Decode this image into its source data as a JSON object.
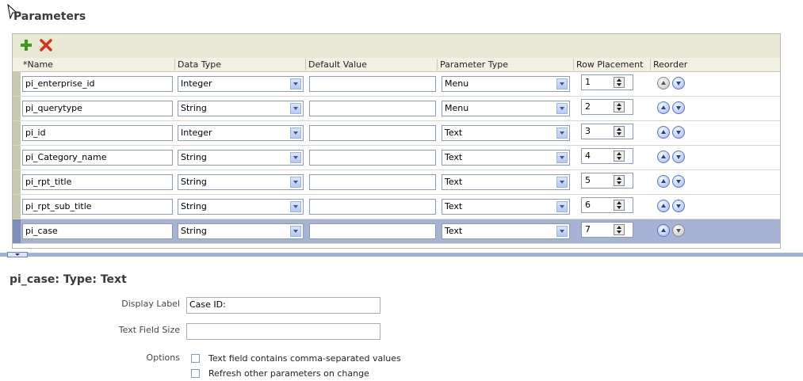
{
  "title": "Parameters",
  "toolbar": {
    "add_icon": "plus-icon",
    "delete_icon": "x-delete-icon"
  },
  "columns": [
    "*Name",
    "Data Type",
    "Default Value",
    "Parameter Type",
    "Row Placement",
    "Reorder"
  ],
  "rows": [
    {
      "name": "pi_enterprise_id",
      "data_type": "Integer",
      "default_value": "",
      "param_type": "Menu",
      "placement": "1"
    },
    {
      "name": "pi_querytype",
      "data_type": "String",
      "default_value": "",
      "param_type": "Menu",
      "placement": "2"
    },
    {
      "name": "pi_id",
      "data_type": "Integer",
      "default_value": "",
      "param_type": "Text",
      "placement": "3"
    },
    {
      "name": "pi_Category_name",
      "data_type": "String",
      "default_value": "",
      "param_type": "Text",
      "placement": "4"
    },
    {
      "name": "pi_rpt_title",
      "data_type": "String",
      "default_value": "",
      "param_type": "Text",
      "placement": "5"
    },
    {
      "name": "pi_rpt_sub_title",
      "data_type": "String",
      "default_value": "",
      "param_type": "Text",
      "placement": "6"
    },
    {
      "name": "pi_case",
      "data_type": "String",
      "default_value": "",
      "param_type": "Text",
      "placement": "7"
    }
  ],
  "detail": {
    "title": "pi_case: Type: Text",
    "display_label_label": "Display Label",
    "display_label_value": "Case ID:",
    "text_field_size_label": "Text Field Size",
    "text_field_size_value": "",
    "options_label": "Options",
    "option1": "Text field contains comma-separated values",
    "option2": "Refresh other parameters on change"
  }
}
